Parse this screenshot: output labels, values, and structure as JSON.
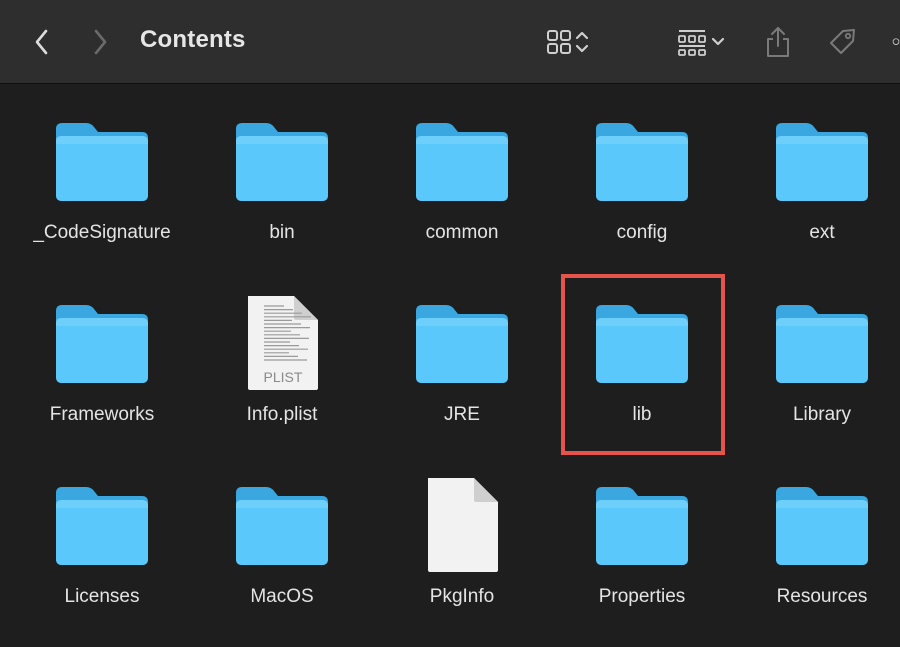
{
  "window": {
    "title": "Contents"
  },
  "toolbar": {
    "back_icon": "chevron-left-icon",
    "forward_icon": "chevron-right-icon",
    "view_icon": "grid-view-icon",
    "group_icon": "group-by-icon",
    "share_icon": "share-icon",
    "tag_icon": "tag-icon"
  },
  "items": [
    {
      "label": "_CodeSignature",
      "kind": "folder"
    },
    {
      "label": "bin",
      "kind": "folder"
    },
    {
      "label": "common",
      "kind": "folder"
    },
    {
      "label": "config",
      "kind": "folder"
    },
    {
      "label": "ext",
      "kind": "folder"
    },
    {
      "label": "Frameworks",
      "kind": "folder"
    },
    {
      "label": "Info.plist",
      "kind": "plist",
      "badge": "PLIST"
    },
    {
      "label": "JRE",
      "kind": "folder"
    },
    {
      "label": "lib",
      "kind": "folder",
      "highlighted": true
    },
    {
      "label": "Library",
      "kind": "folder"
    },
    {
      "label": "Licenses",
      "kind": "folder"
    },
    {
      "label": "MacOS",
      "kind": "folder"
    },
    {
      "label": "PkgInfo",
      "kind": "document"
    },
    {
      "label": "Properties",
      "kind": "folder"
    },
    {
      "label": "Resources",
      "kind": "folder"
    }
  ],
  "colors": {
    "folder": "#5ac8fa",
    "highlight": "#e5534b"
  }
}
